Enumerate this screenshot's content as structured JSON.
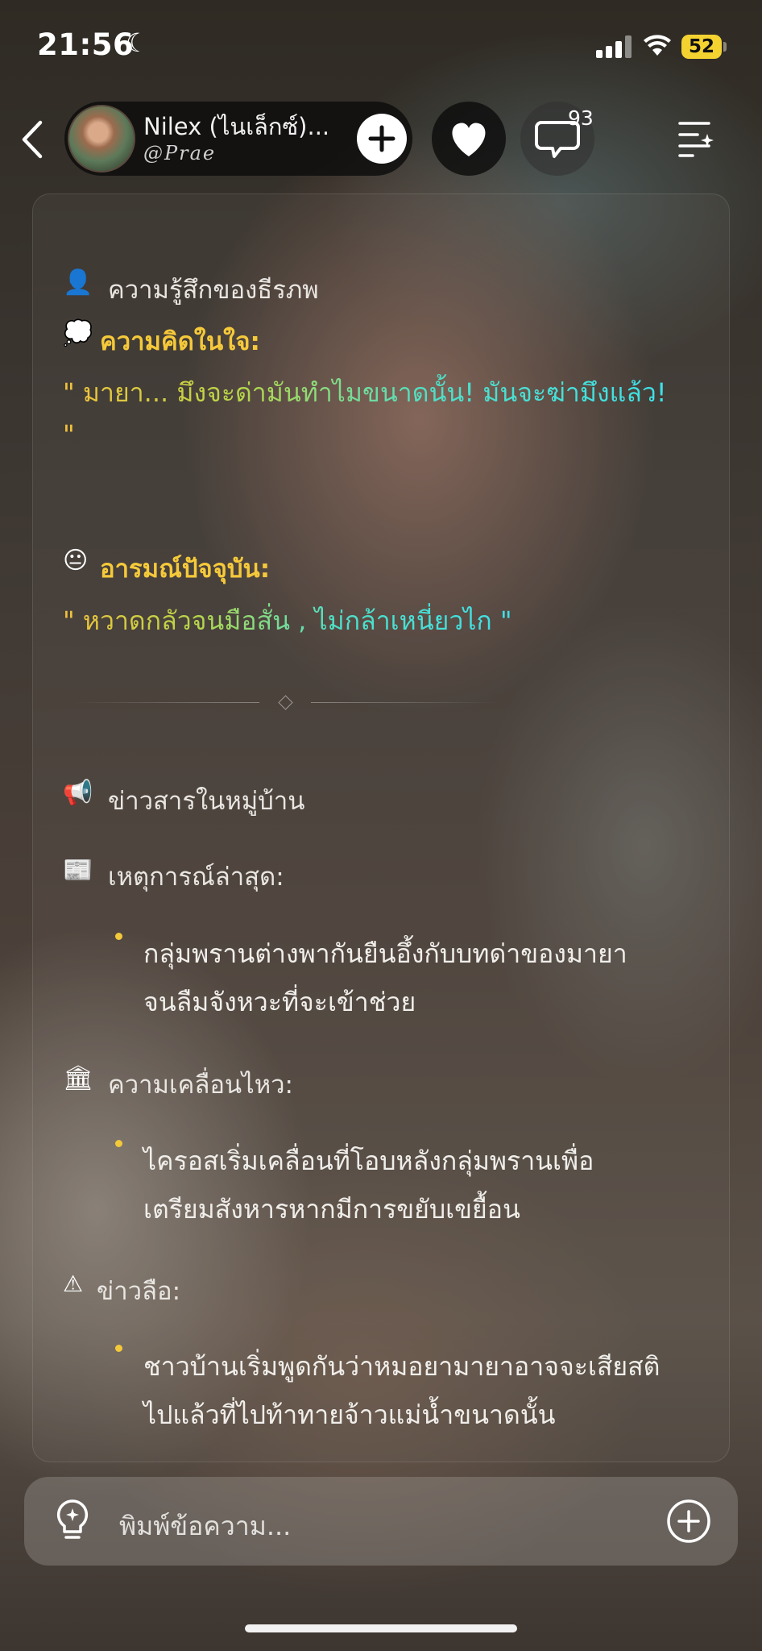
{
  "status_bar": {
    "time": "21:56",
    "battery": "52"
  },
  "header": {
    "name": "Nilex (ไนเล็กซ์)...",
    "handle": "@Prae",
    "comment_count": "93"
  },
  "feelings": {
    "title": "ความรู้สึกของธีรภพ",
    "thought_label": "ความคิดในใจ:",
    "thought_line1": "\" มายา... มึงจะด่ามันทำไมขนาดนั้น! มันจะฆ่ามึงแล้ว!",
    "thought_line2": "\"",
    "emotion_label": "อารมณ์ปัจจุบัน:",
    "emotion_text": "\" หวาดกลัวจนมือสั่น , ไม่กล้าเหนี่ยวไก \""
  },
  "news": {
    "title": "ข่าวสารในหมู่บ้าน",
    "latest_label": "เหตุการณ์ล่าสุด:",
    "latest_line1": "กลุ่มพรานต่างพากันยืนอึ้งกับบทด่าของมายา",
    "latest_line2": "จนลืมจังหวะที่จะเข้าช่วย",
    "movement_label": "ความเคลื่อนไหว:",
    "movement_line1": "ไครอสเริ่มเคลื่อนที่โอบหลังกลุ่มพรานเพื่อ",
    "movement_line2": "เตรียมสังหารหากมีการขยับเขยื้อน",
    "rumor_label": "ข่าวลือ:",
    "rumor_line1": "ชาวบ้านเริ่มพูดกันว่าหมอยามายาอาจจะเสียสติ",
    "rumor_line2": "ไปแล้วที่ไปท้าทายจ้าวแม่น้ำขนาดนั้น"
  },
  "composer": {
    "placeholder": "พิมพ์ข้อความ..."
  },
  "icons": {
    "back": "chevron-left-icon",
    "follow": "plus-icon",
    "like": "heart-icon",
    "comment": "comment-bubble-icon",
    "menu": "menu-sparkle-icon",
    "idea": "lightbulb-icon",
    "add": "add-circle-icon"
  },
  "colors": {
    "accent_yellow": "#f5c93a",
    "quote_cyan": "#3fe0e8"
  }
}
